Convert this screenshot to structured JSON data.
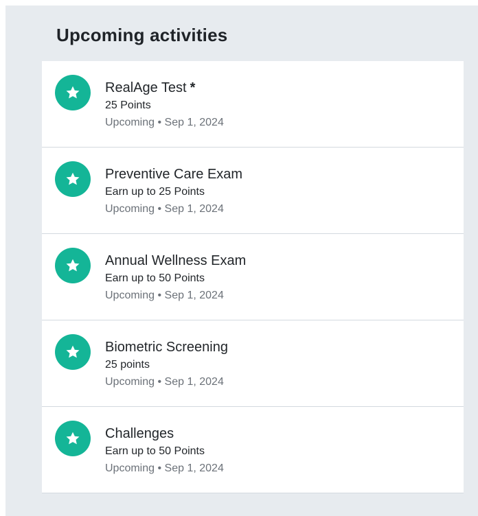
{
  "section": {
    "title": "Upcoming activities"
  },
  "colors": {
    "accent": "#14b597",
    "panel_background": "#e7ebef",
    "card_background": "#ffffff",
    "divider": "#d3d9df"
  },
  "activities": [
    {
      "icon": "star-icon",
      "title": "RealAge Test",
      "required_marker": "*",
      "points": "25 Points",
      "status": "Upcoming",
      "separator": "•",
      "date": "Sep 1, 2024"
    },
    {
      "icon": "star-icon",
      "title": "Preventive Care Exam",
      "points": "Earn up to 25 Points",
      "status": "Upcoming",
      "separator": "•",
      "date": "Sep 1, 2024"
    },
    {
      "icon": "star-icon",
      "title": "Annual Wellness Exam",
      "points": "Earn up to 50 Points",
      "status": "Upcoming",
      "separator": "•",
      "date": "Sep 1, 2024"
    },
    {
      "icon": "star-icon",
      "title": "Biometric Screening",
      "points": "25 points",
      "status": "Upcoming",
      "separator": "•",
      "date": "Sep 1, 2024"
    },
    {
      "icon": "star-icon",
      "title": "Challenges",
      "points": "Earn up to 50 Points",
      "status": "Upcoming",
      "separator": "•",
      "date": "Sep 1, 2024"
    }
  ]
}
